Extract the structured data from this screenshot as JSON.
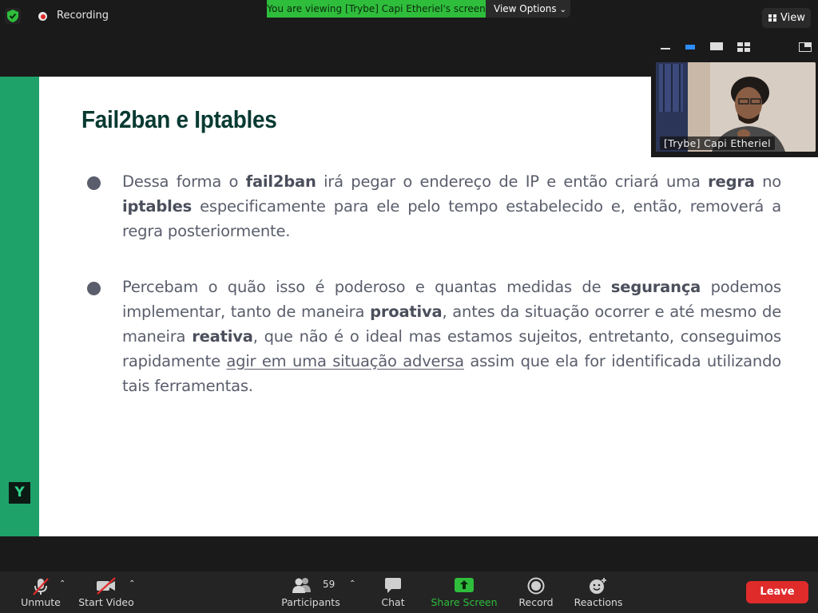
{
  "top_bar": {
    "recording_label": "Recording",
    "viewing_banner": "You are viewing [Trybe] Capi Etheriel's screen",
    "view_options_label": "View Options",
    "view_label": "View"
  },
  "slide": {
    "title": "Fail2ban e Iptables",
    "logo_text": "Y",
    "bullets": [
      {
        "parts": [
          {
            "t": "Dessa forma o "
          },
          {
            "t": "fail2ban",
            "bold": true
          },
          {
            "t": " irá pegar o endereço de IP e então criará uma "
          },
          {
            "t": "regra",
            "bold": true
          },
          {
            "t": " no "
          },
          {
            "t": "iptables",
            "bold": true
          },
          {
            "t": " especificamente para ele pelo tempo estabelecido e, então, removerá a regra posteriormente."
          }
        ]
      },
      {
        "parts": [
          {
            "t": "Percebam o quão isso é poderoso e quantas medidas de "
          },
          {
            "t": "segurança",
            "bold": true
          },
          {
            "t": " podemos implementar, tanto de maneira "
          },
          {
            "t": "proativa",
            "bold": true
          },
          {
            "t": ", antes da situação ocorrer e até mesmo de maneira "
          },
          {
            "t": "reativa",
            "bold": true
          },
          {
            "t": ", que não é o ideal mas estamos sujeitos, entretanto, conseguimos rapidamente "
          },
          {
            "t": "agir em uma situação adversa",
            "underline": true
          },
          {
            "t": " assim que ela for identificada utilizando tais ferramentas."
          }
        ]
      }
    ]
  },
  "video_tile": {
    "participant_name": "[Trybe] Capi Etheriel"
  },
  "toolbar": {
    "unmute_label": "Unmute",
    "start_video_label": "Start Video",
    "participants_label": "Participants",
    "participants_count": "59",
    "chat_label": "Chat",
    "share_screen_label": "Share Screen",
    "record_label": "Record",
    "reactions_label": "Reactions",
    "leave_label": "Leave"
  },
  "colors": {
    "banner_green": "#2fbd3c",
    "slide_accent_green": "#1ea26a",
    "title_color": "#083a32",
    "leave_red": "#e02b2b",
    "share_green": "#2fbd3c"
  },
  "icons": [
    "security-shield-icon",
    "recording-icon",
    "chevron-down-icon",
    "grid-view-icon",
    "minimize-icon",
    "speaker-view-icon",
    "thumbnail-icon",
    "gallery-icon",
    "exit-fullscreen-icon",
    "microphone-muted-icon",
    "video-off-icon",
    "participants-icon",
    "chat-icon",
    "share-screen-icon",
    "record-icon",
    "reactions-icon"
  ]
}
